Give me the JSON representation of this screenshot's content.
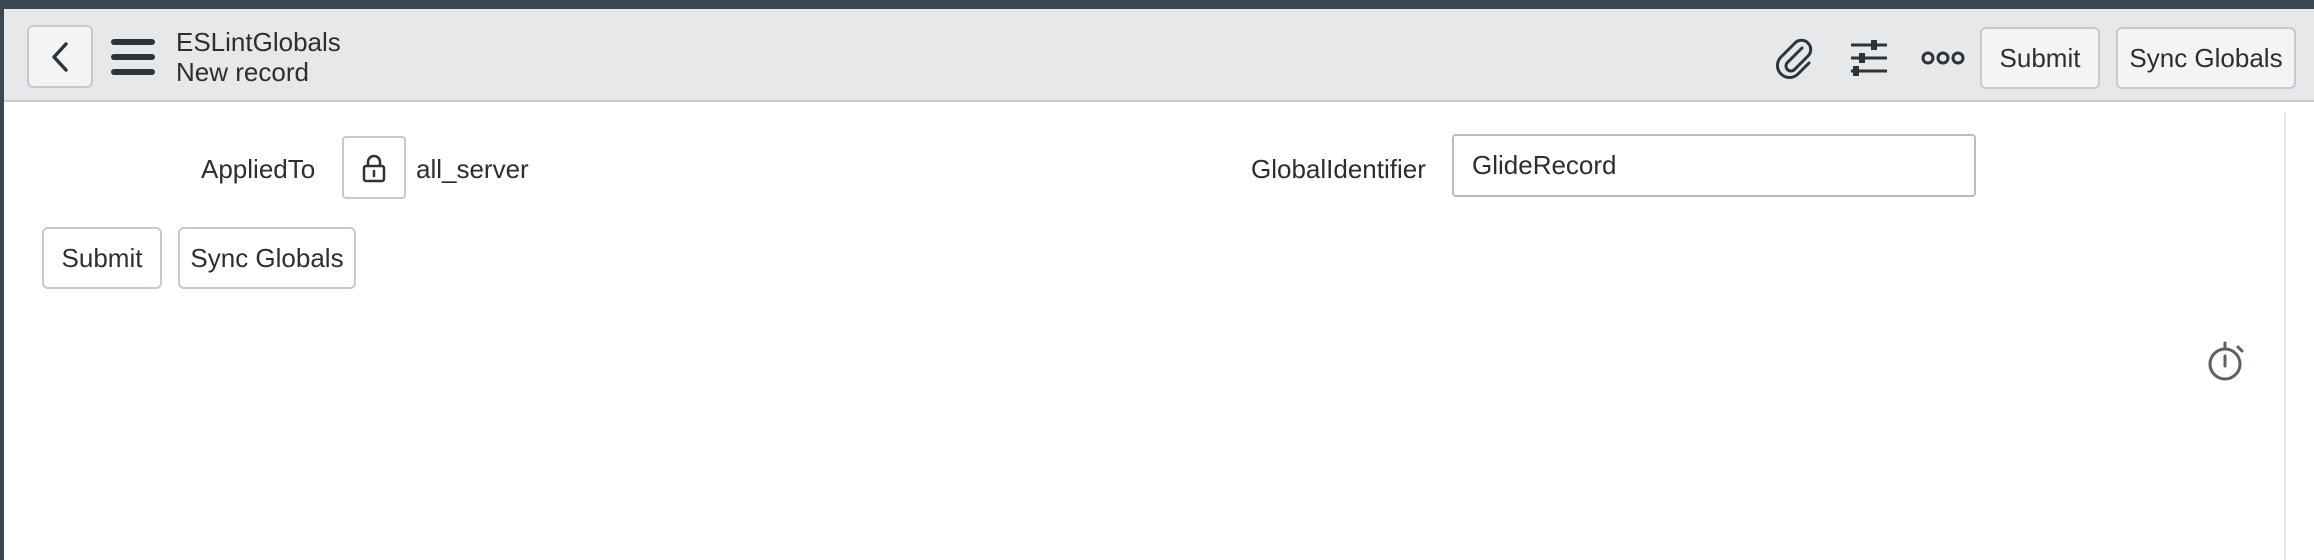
{
  "header": {
    "title": "ESLintGlobals",
    "subtitle": "New record",
    "back_icon": "chevron-left-icon",
    "menu_icon": "hamburger-menu-icon",
    "attachment_icon": "paperclip-icon",
    "settings_icon": "sliders-icon",
    "more_icon": "more-options-icon",
    "submit_label": "Submit",
    "sync_label": "Sync Globals"
  },
  "form": {
    "applied_to": {
      "label": "AppliedTo",
      "value": "all_server",
      "lock_icon": "lock-icon"
    },
    "global_identifier": {
      "label": "GlobalIdentifier",
      "value": "GlideRecord"
    },
    "buttons": {
      "submit_label": "Submit",
      "sync_label": "Sync Globals"
    }
  },
  "timer_icon": "stopwatch-icon",
  "colors": {
    "frame": "#3d4750",
    "header_bg": "#e6e8ea",
    "border": "#c6c9cd",
    "text": "#2e2e2e"
  }
}
